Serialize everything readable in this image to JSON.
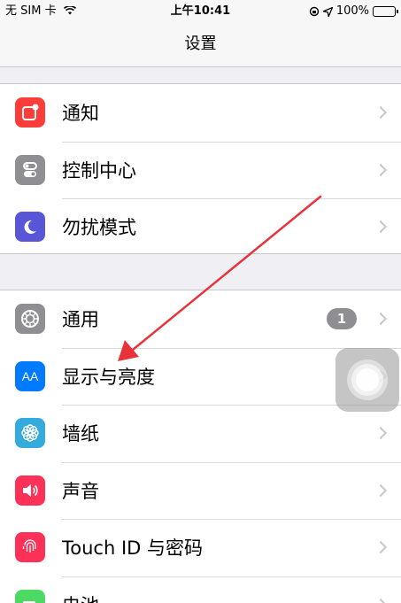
{
  "status_bar": {
    "carrier": "无 SIM 卡",
    "time": "上午10:41",
    "battery_pct": "100%"
  },
  "nav": {
    "title": "设置"
  },
  "groups": [
    {
      "items": [
        {
          "label": "通知",
          "icon": "notifications-icon",
          "color": "#fc3d39"
        },
        {
          "label": "控制中心",
          "icon": "control-center-icon",
          "color": "#8e8e93"
        },
        {
          "label": "勿扰模式",
          "icon": "moon-icon",
          "color": "#5856d6"
        }
      ]
    },
    {
      "items": [
        {
          "label": "通用",
          "icon": "gear-icon",
          "color": "#8e8e93",
          "badge": "1"
        },
        {
          "label": "显示与亮度",
          "icon": "display-brightness-icon",
          "icon_text": "AA",
          "color": "#007aff"
        },
        {
          "label": "墙纸",
          "icon": "wallpaper-flower-icon",
          "color": "#35aadc"
        },
        {
          "label": "声音",
          "icon": "speaker-icon",
          "color": "#fc3158"
        },
        {
          "label": "Touch ID 与密码",
          "icon": "fingerprint-icon",
          "color": "#fc3158"
        },
        {
          "label": "电池",
          "icon": "battery-icon",
          "color": "#4cd964"
        }
      ]
    }
  ],
  "annotation": {
    "color": "#e8333a",
    "icon": "red-arrow-annotation"
  }
}
